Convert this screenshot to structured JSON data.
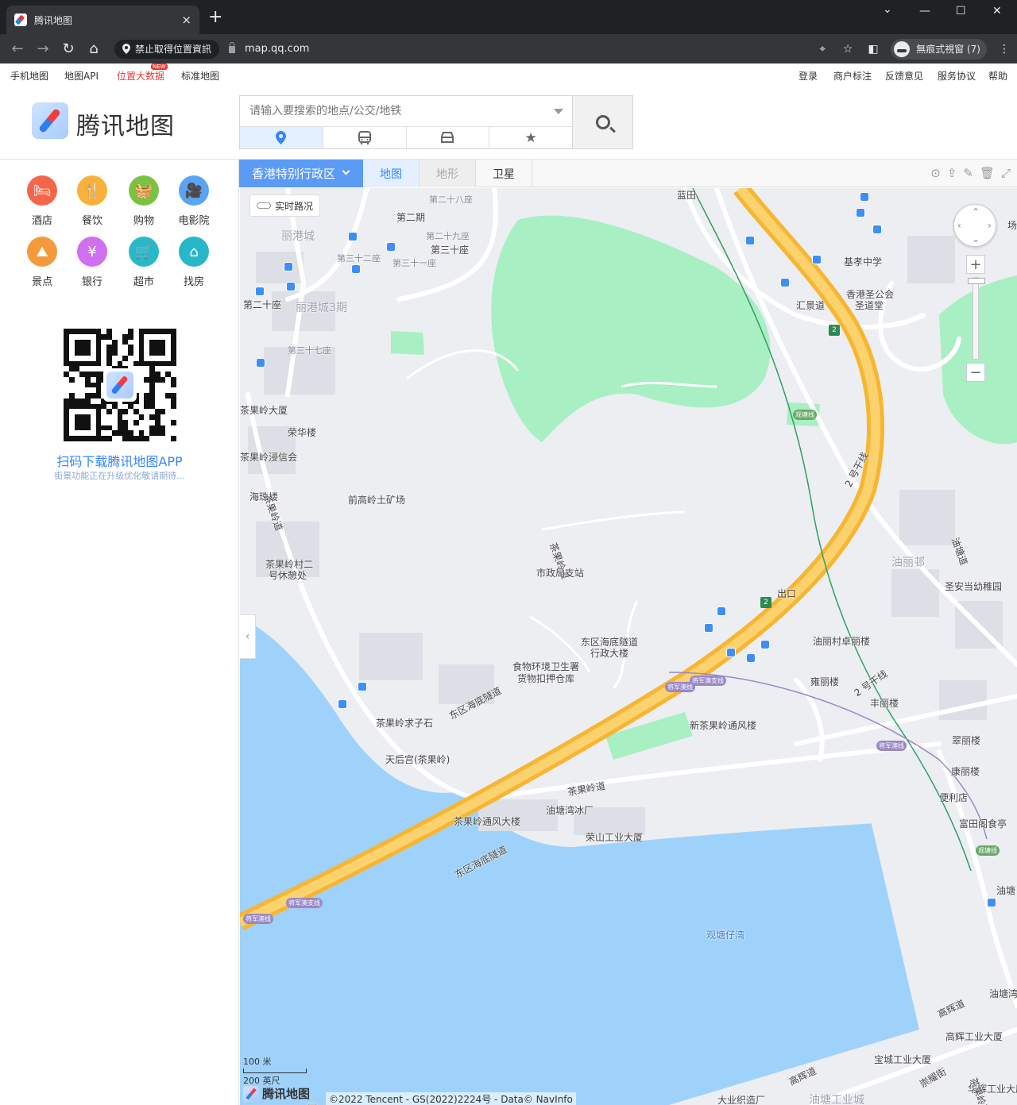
{
  "browser": {
    "tab_title": "腾讯地图",
    "tab_close": "×",
    "new_tab": "+",
    "window_min": "—",
    "window_max": "☐",
    "window_close": "✕",
    "window_down": "⌄",
    "permission_text": "禁止取得位置資訊",
    "url": "map.qq.com",
    "incognito_label": "無痕式視窗 (7)"
  },
  "topnav": {
    "left": [
      "手机地图",
      "地图API",
      "位置大数据",
      "标准地图"
    ],
    "new_badge": "NEW",
    "right": [
      "登录",
      "商户标注",
      "反馈意见",
      "服务协议",
      "帮助"
    ]
  },
  "header": {
    "logo_text": "腾讯地图",
    "search_placeholder": "请输入要搜索的地点/公交/地铁"
  },
  "categories": [
    {
      "label": "酒店",
      "icon": "bed-icon",
      "glyph": "🛏",
      "color": "#f4664a"
    },
    {
      "label": "餐饮",
      "icon": "fork-knife-icon",
      "glyph": "🍴",
      "color": "#fbb03b"
    },
    {
      "label": "购物",
      "icon": "basket-icon",
      "glyph": "🧺",
      "color": "#7cc242"
    },
    {
      "label": "电影院",
      "icon": "camera-icon",
      "glyph": "🎥",
      "color": "#5aa4f5"
    },
    {
      "label": "景点",
      "icon": "landscape-icon",
      "glyph": "⛰",
      "color": "#f49a3d"
    },
    {
      "label": "银行",
      "icon": "yen-icon",
      "glyph": "¥",
      "color": "#d06ff0"
    },
    {
      "label": "超市",
      "icon": "cart-icon",
      "glyph": "🛒",
      "color": "#28b9c9"
    },
    {
      "label": "找房",
      "icon": "house-icon",
      "glyph": "⌂",
      "color": "#27b7c8"
    }
  ],
  "qr": {
    "title": "扫码下载腾讯地图APP",
    "subtitle": "街景功能正在升级优化敬请期待..."
  },
  "map_tabs": {
    "region": "香港特别行政区",
    "tabs": [
      "地图",
      "地形",
      "卫星"
    ]
  },
  "map": {
    "traffic_label": "实时路况",
    "scale_metric": "100 米",
    "scale_imperial": "200 英尺",
    "logo_text": "腾讯地图",
    "copyright": "©2022 Tencent - GS(2022)2224号 - Data© NavInfo",
    "labels": [
      {
        "t": "第二十八座",
        "c": "small"
      },
      {
        "t": "第二期",
        "c": ""
      },
      {
        "t": "第二十九座",
        "c": "small"
      },
      {
        "t": "第三十座",
        "c": ""
      },
      {
        "t": "第三十二座",
        "c": "small"
      },
      {
        "t": "第三十一座",
        "c": "small"
      },
      {
        "t": "丽港城",
        "c": "gray"
      },
      {
        "t": "丽港城3期",
        "c": "gray"
      },
      {
        "t": "第二十座",
        "c": ""
      },
      {
        "t": "第三十七座",
        "c": "small"
      },
      {
        "t": "茶果岭大厦",
        "c": ""
      },
      {
        "t": "荣华楼",
        "c": ""
      },
      {
        "t": "茶果岭浸信会",
        "c": ""
      },
      {
        "t": "海珠楼",
        "c": ""
      },
      {
        "t": "前高岭土矿场",
        "c": ""
      },
      {
        "t": "茶果岭村二",
        "c": ""
      },
      {
        "t": "号休憩处",
        "c": ""
      },
      {
        "t": "茶果岭道",
        "c": ""
      },
      {
        "t": "市政局支站",
        "c": ""
      },
      {
        "t": "东区海底隧道",
        "c": ""
      },
      {
        "t": "行政大楼",
        "c": ""
      },
      {
        "t": "食物环境卫生署",
        "c": ""
      },
      {
        "t": "货物扣押仓库",
        "c": ""
      },
      {
        "t": "茶果岭求子石",
        "c": ""
      },
      {
        "t": "天后宫(茶果岭)",
        "c": ""
      },
      {
        "t": "茶果岭通风大楼",
        "c": ""
      },
      {
        "t": "油塘湾冰厂",
        "c": ""
      },
      {
        "t": "荣山工业大厦",
        "c": ""
      },
      {
        "t": "观塘仔湾",
        "c": "blue"
      },
      {
        "t": "蓝田",
        "c": ""
      },
      {
        "t": "基孝中学",
        "c": ""
      },
      {
        "t": "香港圣公会",
        "c": ""
      },
      {
        "t": "圣道堂",
        "c": ""
      },
      {
        "t": "汇景道",
        "c": ""
      },
      {
        "t": "油丽邨",
        "c": "gray"
      },
      {
        "t": "圣安当幼稚园",
        "c": ""
      },
      {
        "t": "油丽村卓丽楼",
        "c": ""
      },
      {
        "t": "雍丽楼",
        "c": ""
      },
      {
        "t": "丰丽楼",
        "c": ""
      },
      {
        "t": "新茶果岭通风楼",
        "c": ""
      },
      {
        "t": "翠丽楼",
        "c": ""
      },
      {
        "t": "康丽楼",
        "c": ""
      },
      {
        "t": "便利店",
        "c": ""
      },
      {
        "t": "富田阁食亭",
        "c": ""
      },
      {
        "t": "油塘",
        "c": ""
      },
      {
        "t": "油塘湾",
        "c": ""
      },
      {
        "t": "高辉工业大厦",
        "c": ""
      },
      {
        "t": "宝城工业大厦",
        "c": ""
      },
      {
        "t": "华辉工业大厦",
        "c": ""
      },
      {
        "t": "大业织造厂",
        "c": ""
      },
      {
        "t": "油塘工业城",
        "c": "gray"
      },
      {
        "t": "茶果岭道",
        "c": ""
      },
      {
        "t": "高辉道",
        "c": ""
      },
      {
        "t": "高辉道",
        "c": ""
      },
      {
        "t": "崇耀街",
        "c": ""
      },
      {
        "t": "2 号干线",
        "c": ""
      },
      {
        "t": "2 号干线",
        "c": ""
      },
      {
        "t": "东区海底隧道",
        "c": ""
      },
      {
        "t": "东区海底隧道",
        "c": ""
      },
      {
        "t": "居",
        "c": "gray"
      },
      {
        "t": "场",
        "c": ""
      },
      {
        "t": "出口",
        "c": ""
      },
      {
        "t": "茶果岭道",
        "c": ""
      },
      {
        "t": "油塘道",
        "c": ""
      },
      {
        "t": "茶果岭道",
        "c": ""
      }
    ],
    "metro": [
      {
        "t": "观塘线",
        "c": ""
      },
      {
        "t": "将军澳支线",
        "c": "p"
      },
      {
        "t": "将军澳线",
        "c": "p"
      },
      {
        "t": "将军澳线",
        "c": "p"
      },
      {
        "t": "观塘线",
        "c": ""
      },
      {
        "t": "将军澳支线",
        "c": "p"
      },
      {
        "t": "将军澳线",
        "c": "p"
      }
    ]
  }
}
